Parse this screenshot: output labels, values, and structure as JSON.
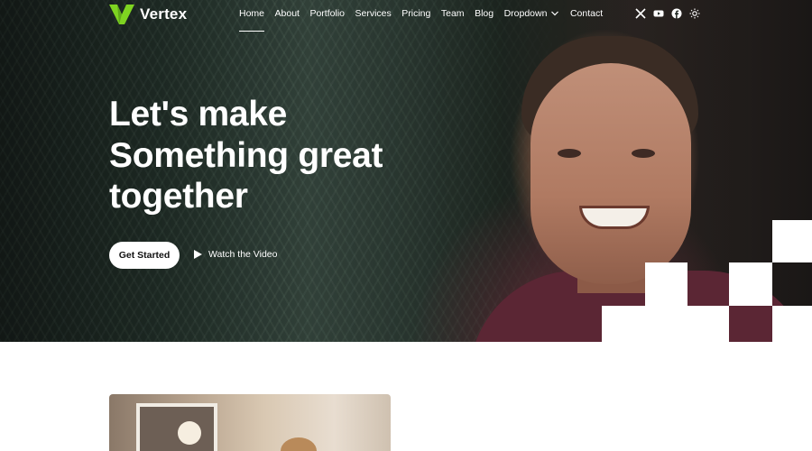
{
  "brand": {
    "name": "Vertex",
    "accent_color": "#7ed321",
    "logo_icon": "v-logo-icon"
  },
  "nav": {
    "items": [
      {
        "label": "Home",
        "active": true
      },
      {
        "label": "About"
      },
      {
        "label": "Portfolio"
      },
      {
        "label": "Services"
      },
      {
        "label": "Pricing"
      },
      {
        "label": "Team"
      },
      {
        "label": "Blog"
      },
      {
        "label": "Dropdown",
        "icon": "chevron-down-icon"
      },
      {
        "label": "Contact"
      }
    ],
    "social_icons": [
      "x-twitter-icon",
      "youtube-icon",
      "facebook-icon",
      "sun-theme-icon"
    ]
  },
  "hero": {
    "headline": [
      "Let's make",
      "Something great",
      "together"
    ],
    "cta_label": "Get Started",
    "video_label": "Watch the Video",
    "video_icon": "play-icon"
  }
}
